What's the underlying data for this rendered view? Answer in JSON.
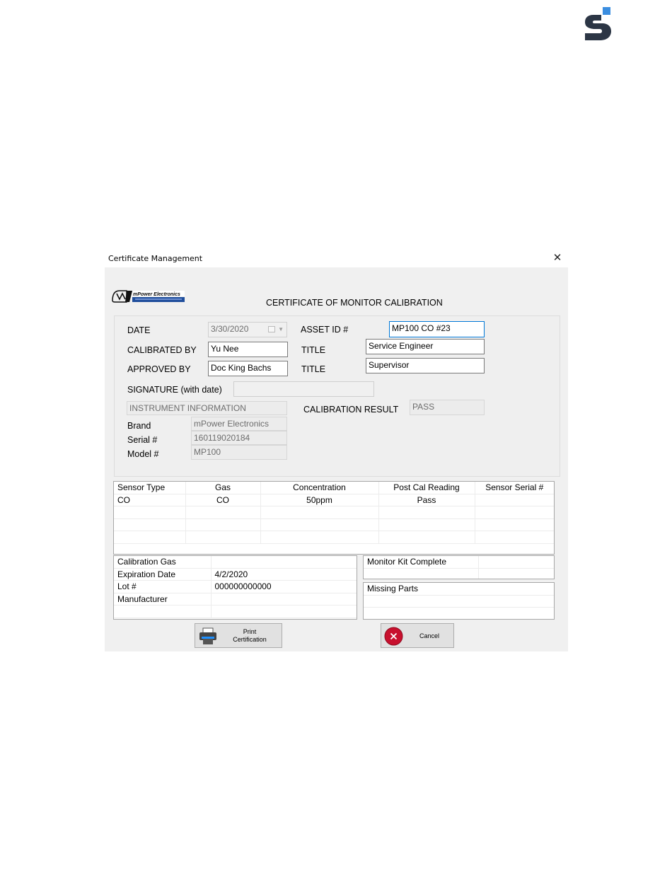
{
  "window": {
    "title": "Certificate Management",
    "close_glyph": "✕"
  },
  "certificate": {
    "heading": "CERTIFICATE OF MONITOR CALIBRATION",
    "date_label": "DATE",
    "date_value": "3/30/2020",
    "asset_label": "ASSET ID #",
    "asset_value": "MP100 CO #23",
    "calibrated_by_label": "CALIBRATED BY",
    "calibrated_by_value": "Yu Nee",
    "title_label": "TITLE",
    "calibrated_title_value": "Service Engineer",
    "approved_by_label": "APPROVED BY",
    "approved_by_value": "Doc King Bachs",
    "approved_title_value": "Supervisor",
    "signature_label": "SIGNATURE (with date)",
    "signature_value": ""
  },
  "instrument": {
    "header": "INSTRUMENT INFORMATION",
    "brand_label": "Brand",
    "brand_value": "mPower Electronics",
    "serial_label": "Serial #",
    "serial_value": "160119020184",
    "model_label": "Model #",
    "model_value": "MP100"
  },
  "result": {
    "label": "CALIBRATION RESULT",
    "value": "PASS"
  },
  "sensor_table": {
    "columns": [
      "Sensor Type",
      "Gas",
      "Concentration",
      "Post Cal Reading",
      "Sensor Serial #"
    ],
    "rows": [
      [
        "CO",
        "CO",
        "50ppm",
        "Pass",
        ""
      ],
      [
        "",
        "",
        "",
        "",
        ""
      ],
      [
        "",
        "",
        "",
        "",
        ""
      ],
      [
        "",
        "",
        "",
        "",
        ""
      ]
    ]
  },
  "gas_table": {
    "rows": [
      [
        "Calibration Gas",
        ""
      ],
      [
        "Expiration Date",
        "4/2/2020"
      ],
      [
        "Lot #",
        "000000000000"
      ],
      [
        "Manufacturer",
        ""
      ],
      [
        "",
        ""
      ]
    ]
  },
  "kit_table": {
    "rows": [
      [
        "Monitor Kit Complete",
        ""
      ],
      [
        "",
        ""
      ]
    ]
  },
  "missing_table": {
    "rows": [
      [
        "Missing Parts"
      ],
      [
        ""
      ],
      [
        ""
      ]
    ]
  },
  "buttons": {
    "print_line1": "Print",
    "print_line2": "Certification",
    "cancel": "Cancel"
  },
  "icons": {
    "brand": "brand-logo-icon",
    "printer": "printer-icon",
    "cancel": "cancel-icon",
    "calendar": "calendar-icon",
    "close": "close-icon"
  },
  "colors": {
    "focus_border": "#0078d7",
    "cancel_red": "#c8102e",
    "brand_blue": "#1f4e9c"
  }
}
